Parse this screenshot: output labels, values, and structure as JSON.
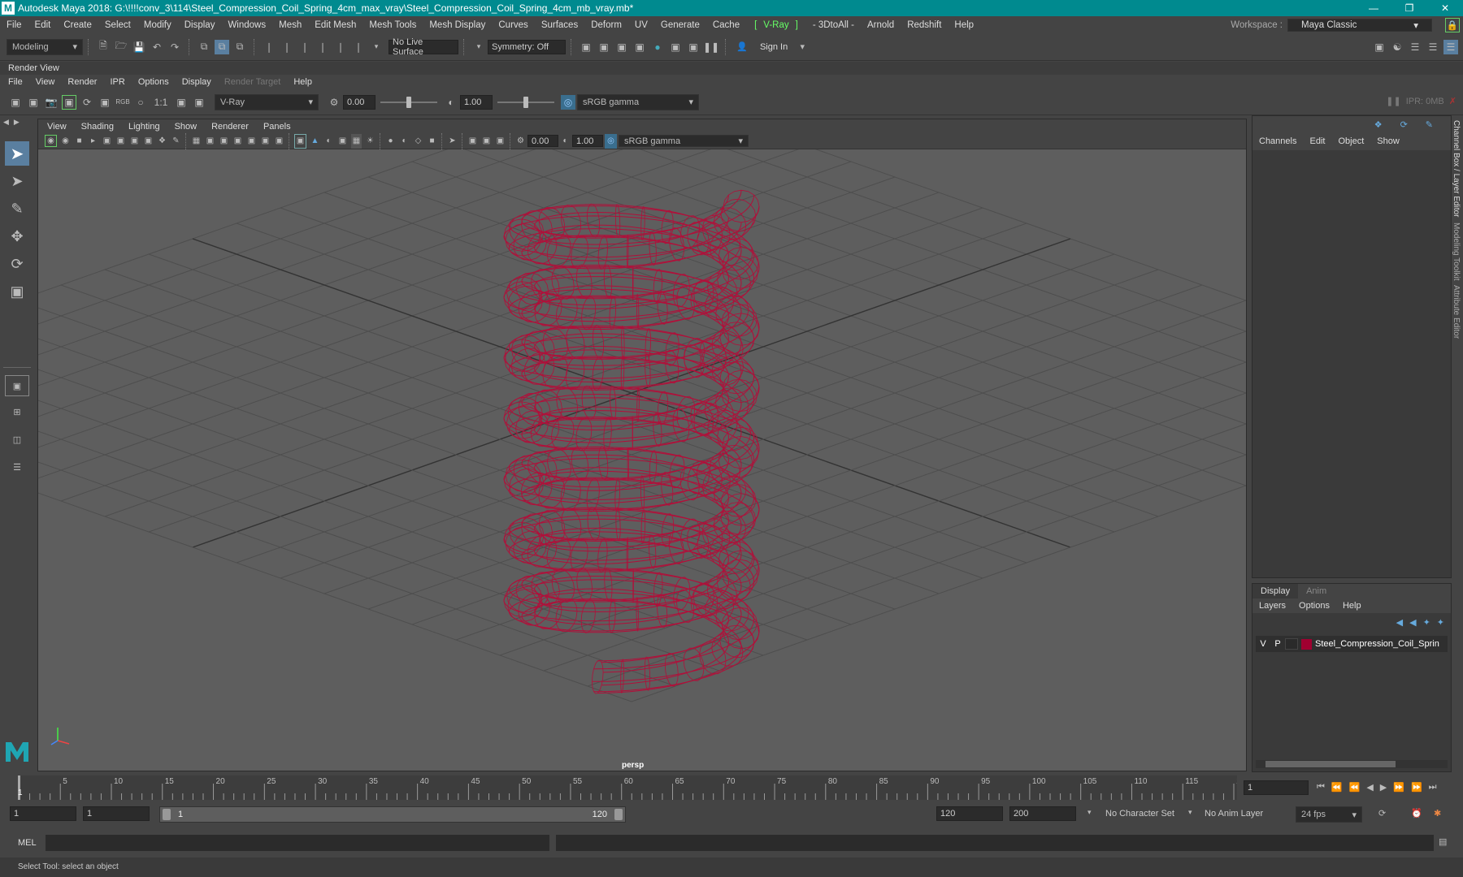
{
  "titlebar": {
    "title": "Autodesk Maya 2018: G:\\!!!!conv_3\\114\\Steel_Compression_Coil_Spring_4cm_max_vray\\Steel_Compression_Coil_Spring_4cm_mb_vray.mb*",
    "app_icon": "M"
  },
  "menu": [
    "File",
    "Edit",
    "Create",
    "Select",
    "Modify",
    "Display",
    "Windows",
    "Mesh",
    "Edit Mesh",
    "Mesh Tools",
    "Mesh Display",
    "Curves",
    "Surfaces",
    "Deform",
    "UV",
    "Generate",
    "Cache",
    "V-Ray",
    "- 3DtoAll -",
    "Arnold",
    "Redshift",
    "Help"
  ],
  "workspace": {
    "label": "Workspace :",
    "value": "Maya Classic"
  },
  "shelf": {
    "mode": "Modeling",
    "live_surface": "No Live Surface",
    "symmetry": "Symmetry: Off",
    "sign_in": "Sign In"
  },
  "render_view": {
    "title": "Render View",
    "menu": [
      "File",
      "View",
      "Render",
      "IPR",
      "Options",
      "Display",
      "Render Target",
      "Help"
    ],
    "ratio": "1:1",
    "renderer": "V-Ray",
    "exposure": "0.00",
    "gamma": "1.00",
    "color_space": "sRGB gamma",
    "ipr_status": "IPR: 0MB"
  },
  "viewport": {
    "menu": [
      "View",
      "Shading",
      "Lighting",
      "Show",
      "Renderer",
      "Panels"
    ],
    "exposure": "0.00",
    "gamma": "1.00",
    "color_space": "sRGB gamma",
    "camera_label": "persp",
    "wire_color": "#b0103a"
  },
  "channel_box": {
    "menu": [
      "Channels",
      "Edit",
      "Object",
      "Show"
    ]
  },
  "layer_editor": {
    "tabs": [
      "Display",
      "Anim"
    ],
    "menu": [
      "Layers",
      "Options",
      "Help"
    ],
    "layers": [
      {
        "v": "V",
        "p": "P",
        "color": "#a00030",
        "name": "Steel_Compression_Coil_Sprin"
      }
    ]
  },
  "side_tabs": [
    "Channel Box / Layer Editor",
    "Modeling Toolkit",
    "Attribute Editor"
  ],
  "timeline": {
    "ticks": [
      "5",
      "10",
      "15",
      "20",
      "25",
      "30",
      "35",
      "40",
      "45",
      "50",
      "55",
      "60",
      "65",
      "70",
      "75",
      "80",
      "85",
      "90",
      "95",
      "100",
      "105",
      "110",
      "115",
      "120"
    ],
    "current_frame_marker": "1",
    "current_frame": "1"
  },
  "range": {
    "start": "1",
    "playback_start": "1",
    "slider_start": "1",
    "slider_end": "120",
    "playback_end": "120",
    "end": "200",
    "character_set": "No Character Set",
    "anim_layer": "No Anim Layer",
    "fps": "24 fps"
  },
  "command_line": {
    "label": "MEL"
  },
  "help_line": "Select Tool: select an object"
}
